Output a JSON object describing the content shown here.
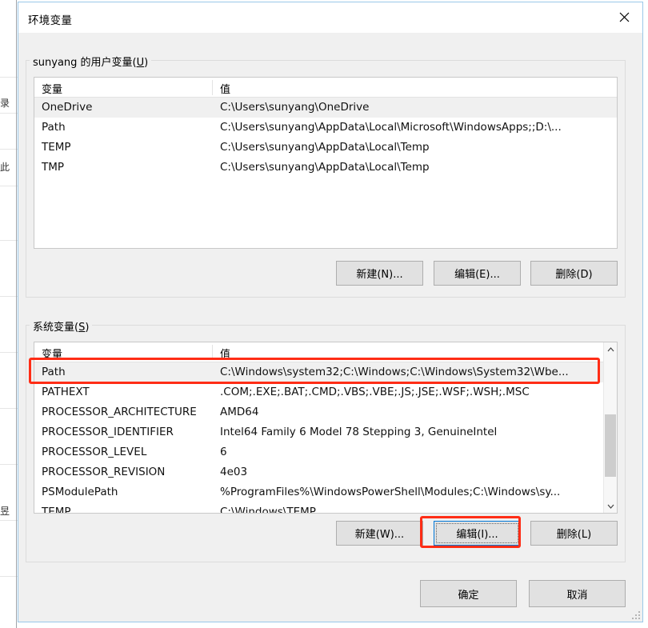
{
  "window": {
    "title": "环境变量",
    "close_icon": "close-icon"
  },
  "user_section": {
    "legend_prefix": "sunyang",
    "legend": "sunyang 的用户变量(U)",
    "columns": [
      "变量",
      "值"
    ],
    "rows": [
      {
        "name": "OneDrive",
        "value": "C:\\Users\\sunyang\\OneDrive",
        "selected": true
      },
      {
        "name": "Path",
        "value": "C:\\Users\\sunyang\\AppData\\Local\\Microsoft\\WindowsApps;;D:\\...",
        "selected": false
      },
      {
        "name": "TEMP",
        "value": "C:\\Users\\sunyang\\AppData\\Local\\Temp",
        "selected": false
      },
      {
        "name": "TMP",
        "value": "C:\\Users\\sunyang\\AppData\\Local\\Temp",
        "selected": false
      }
    ],
    "buttons": {
      "new": "新建(N)...",
      "edit": "编辑(E)...",
      "delete": "删除(D)"
    }
  },
  "system_section": {
    "legend": "系统变量(S)",
    "columns": [
      "变量",
      "值"
    ],
    "rows": [
      {
        "name": "Path",
        "value": "C:\\Windows\\system32;C:\\Windows;C:\\Windows\\System32\\Wbe...",
        "selected": true,
        "highlighted": true
      },
      {
        "name": "PATHEXT",
        "value": ".COM;.EXE;.BAT;.CMD;.VBS;.VBE;.JS;.JSE;.WSF;.WSH;.MSC",
        "selected": false,
        "highlighted": false
      },
      {
        "name": "PROCESSOR_ARCHITECTURE",
        "value": "AMD64",
        "selected": false,
        "highlighted": false
      },
      {
        "name": "PROCESSOR_IDENTIFIER",
        "value": "Intel64 Family 6 Model 78 Stepping 3, GenuineIntel",
        "selected": false,
        "highlighted": false
      },
      {
        "name": "PROCESSOR_LEVEL",
        "value": "6",
        "selected": false,
        "highlighted": false
      },
      {
        "name": "PROCESSOR_REVISION",
        "value": "4e03",
        "selected": false,
        "highlighted": false
      },
      {
        "name": "PSModulePath",
        "value": "%ProgramFiles%\\WindowsPowerShell\\Modules;C:\\Windows\\sy...",
        "selected": false,
        "highlighted": false
      },
      {
        "name": "TEMP",
        "value": "C:\\Windows\\TEMP",
        "selected": false,
        "highlighted": false
      }
    ],
    "scrollbar": {
      "up_icon": "chevron-up-icon",
      "down_icon": "chevron-down-icon"
    },
    "buttons": {
      "new": "新建(W)...",
      "edit": "编辑(I)...",
      "delete": "删除(L)"
    }
  },
  "footer": {
    "ok": "确定",
    "cancel": "取消"
  },
  "annotations": {
    "highlight_color": "#ff2d16",
    "focus_color": "#0078d7"
  }
}
